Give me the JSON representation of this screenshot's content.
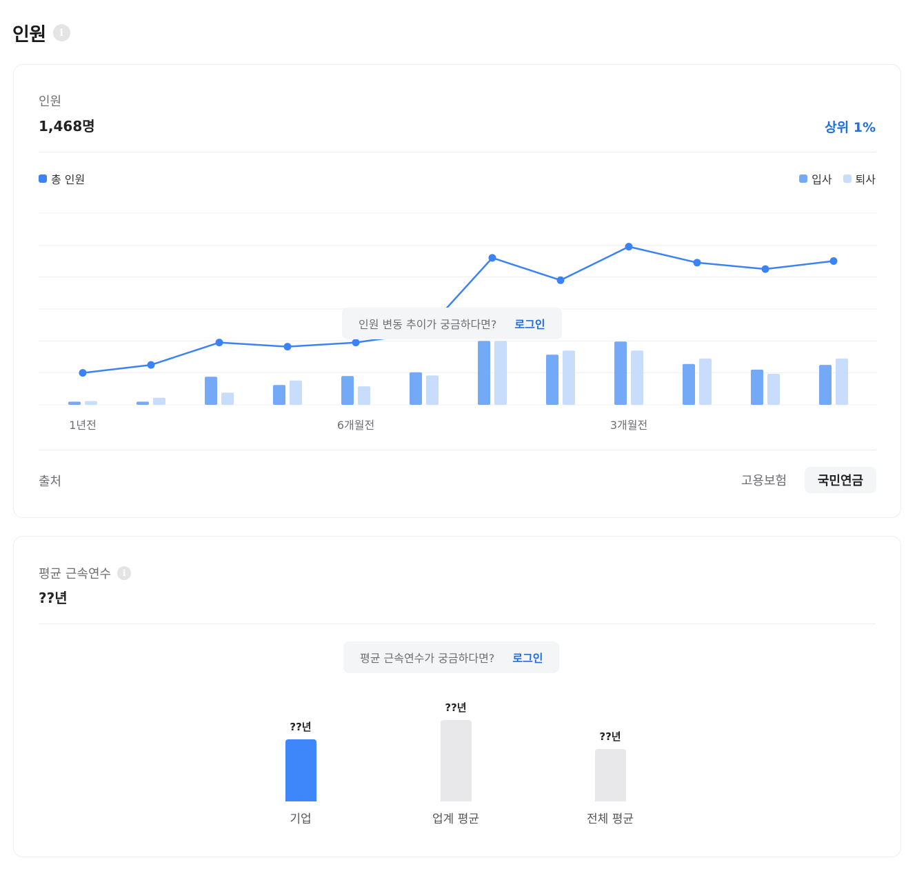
{
  "header": {
    "title": "인원",
    "info_icon": "info-icon"
  },
  "headcount": {
    "label": "인원",
    "value": "1,468명",
    "rank": "상위 1%",
    "legend_total": "총 인원",
    "legend_join": "입사",
    "legend_leave": "퇴사",
    "tooltip_text": "인원 변동 추이가 궁금하다면?",
    "tooltip_login": "로그인",
    "source_label": "출처",
    "source_tabs": [
      "고용보험",
      "국민연금"
    ],
    "active_source": "국민연금"
  },
  "chart_data": {
    "type": "bar+line",
    "x_tick_labels": [
      "1년전",
      "",
      "",
      "",
      "6개월전",
      "",
      "",
      "",
      "3개월전",
      "",
      "",
      ""
    ],
    "series": [
      {
        "name": "총 인원",
        "type": "line",
        "values": [
          1.0,
          1.25,
          1.95,
          1.82,
          1.95,
          2.25,
          4.6,
          3.9,
          4.95,
          4.45,
          4.25,
          4.5
        ]
      },
      {
        "name": "입사",
        "type": "bar",
        "values": [
          0.1,
          0.1,
          0.88,
          0.62,
          0.9,
          1.02,
          2.0,
          1.57,
          1.98,
          1.28,
          1.1,
          1.25
        ]
      },
      {
        "name": "퇴사",
        "type": "bar",
        "values": [
          0.12,
          0.22,
          0.38,
          0.76,
          0.58,
          0.92,
          2.0,
          1.7,
          1.7,
          1.45,
          0.97,
          1.45
        ]
      }
    ],
    "ylim": [
      0,
      6
    ],
    "grid": true,
    "colors": {
      "line": "#3b82f6",
      "join": "#74a9f8",
      "leave": "#c8dcfb",
      "grid": "#f0f0f2"
    }
  },
  "tenure": {
    "label": "평균 근속연수",
    "value": "??년",
    "tooltip_text": "평균 근속연수가 궁금하다면?",
    "tooltip_login": "로그인",
    "bars": [
      {
        "label": "기업",
        "value_text": "??년",
        "level": 0.43,
        "color": "#3d87fb"
      },
      {
        "label": "업계 평균",
        "value_text": "??년",
        "level": 0.56,
        "color": "#e8e8ea"
      },
      {
        "label": "전체 평균",
        "value_text": "??년",
        "level": 0.36,
        "color": "#e8e8ea"
      }
    ]
  }
}
